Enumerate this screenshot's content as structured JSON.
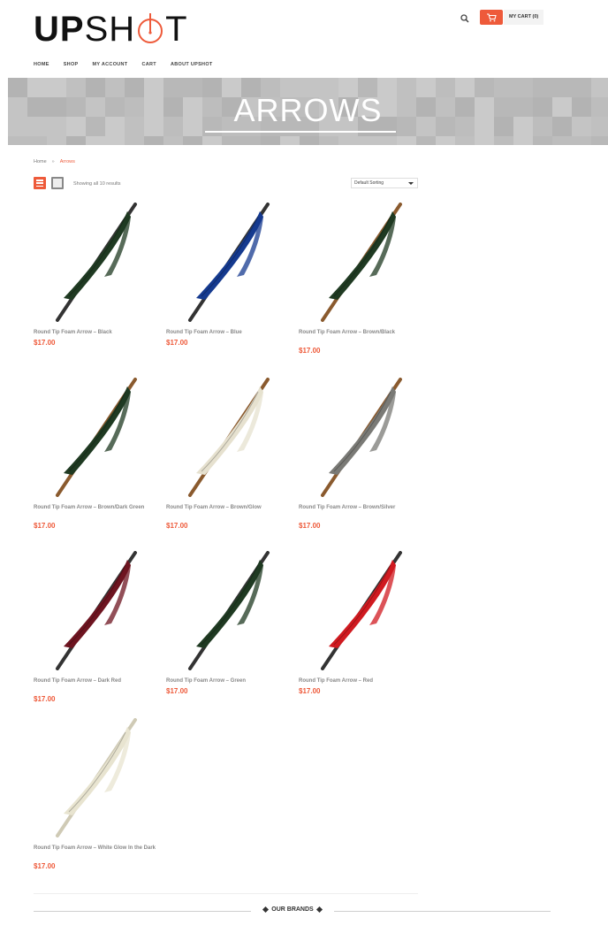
{
  "logo": {
    "part1": "UP",
    "part2_pre": "SH",
    "part2_post": "T"
  },
  "header": {
    "cart_label": "MY CART (0)"
  },
  "nav": {
    "items": [
      "HOME",
      "SHOP",
      "MY ACCOUNT",
      "CART",
      "ABOUT UPSHOT"
    ]
  },
  "banner": {
    "title": "ARROWS"
  },
  "breadcrumb": {
    "home": "Home",
    "separator": "»",
    "current": "Arrows"
  },
  "toolbar": {
    "result_count": "Showing all 10 results",
    "sort_selected": "Default Sorting"
  },
  "colors": {
    "accent": "#ee5a3a",
    "banner_gray": "#c2c2c2"
  },
  "products": [
    {
      "name": "Round Tip Foam Arrow – Black",
      "price": "$17.00",
      "fletch": "#1f3a22",
      "shaft": "#333333"
    },
    {
      "name": "Round Tip Foam Arrow – Blue",
      "price": "$17.00",
      "fletch": "#153a8f",
      "shaft": "#333333"
    },
    {
      "name": "Round Tip Foam Arrow – Brown/Black",
      "price": "$17.00",
      "fletch": "#1f3a22",
      "shaft": "#8a5a2e"
    },
    {
      "name": "Round Tip Foam Arrow – Brown/Dark Green",
      "price": "$17.00",
      "fletch": "#1f3a22",
      "shaft": "#8a5a2e"
    },
    {
      "name": "Round Tip Foam Arrow – Brown/Glow",
      "price": "$17.00",
      "fletch": "#e6e1cf",
      "shaft": "#8a5a2e"
    },
    {
      "name": "Round Tip Foam Arrow – Brown/Silver",
      "price": "$17.00",
      "fletch": "#7a7a76",
      "shaft": "#8a5a2e"
    },
    {
      "name": "Round Tip Foam Arrow – Dark Red",
      "price": "$17.00",
      "fletch": "#6e1420",
      "shaft": "#333333"
    },
    {
      "name": "Round Tip Foam Arrow – Green",
      "price": "$17.00",
      "fletch": "#1f3a22",
      "shaft": "#333333"
    },
    {
      "name": "Round Tip Foam Arrow – Red",
      "price": "$17.00",
      "fletch": "#d01a20",
      "shaft": "#333333"
    },
    {
      "name": "Round Tip Foam Arrow – White Glow In the Dark",
      "price": "$17.00",
      "fletch": "#e8e4d0",
      "shaft": "#cfcab5"
    }
  ],
  "brands": {
    "title": "OUR BRANDS"
  }
}
